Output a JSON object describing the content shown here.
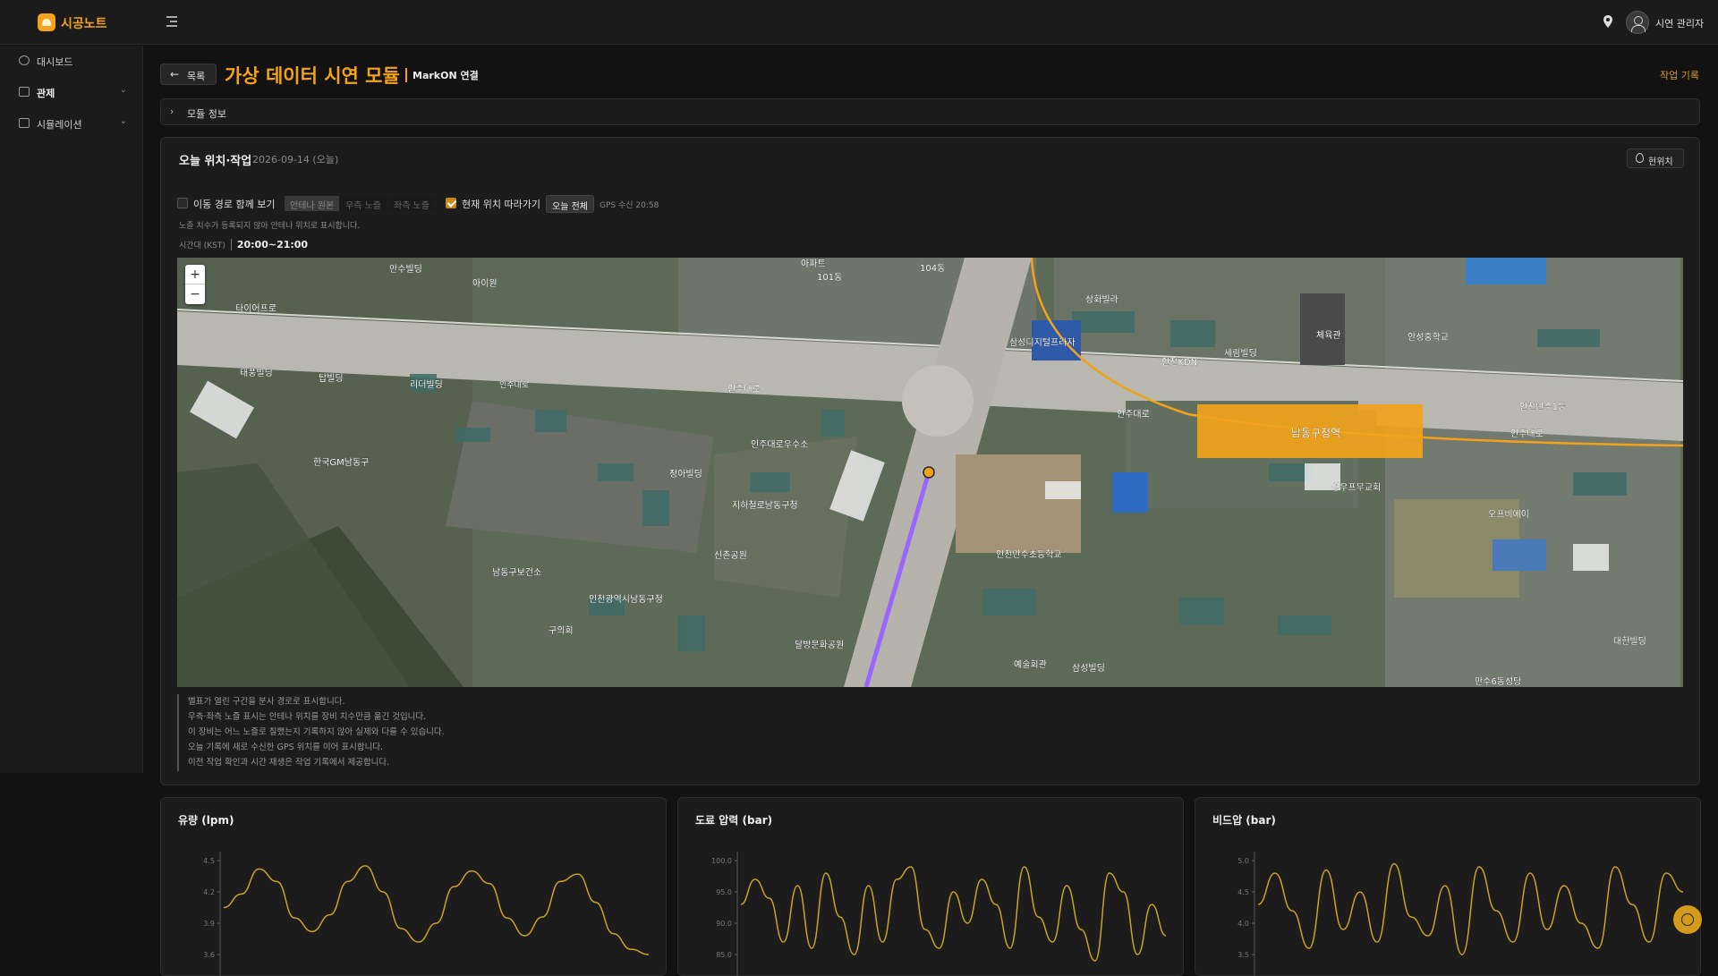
{
  "app": {
    "brand": "시공노트",
    "user": "시연 관리자"
  },
  "sidebar": {
    "items": [
      {
        "label": "대시보드",
        "icon": "dashboard-icon"
      },
      {
        "label": "관제",
        "icon": "monitor-grid-icon",
        "expandable": true
      },
      {
        "label": "시뮬레이션",
        "icon": "screen-icon",
        "expandable": true
      }
    ]
  },
  "header": {
    "back_label": "목록",
    "title": "가상 데이터 시연 모듈",
    "tag": "MarkON 연결",
    "work_log": "작업 기록"
  },
  "module_info": {
    "label": "모듈 정보"
  },
  "location_card": {
    "title": "오늘 위치·작업",
    "date": "2026-09-14 (오늘)",
    "current_location_btn": "현위치",
    "show_route_label": "이동 경로 함께 보기",
    "show_route_checked": false,
    "view_modes": [
      "안테나 원본",
      "우측 노즐",
      "좌측 노즐"
    ],
    "view_mode_selected": "안테나 원본",
    "follow_label": "현재 위치 따라가기",
    "follow_checked": true,
    "today_all_btn": "오늘 전체",
    "gps_received": "GPS 수신 20:58",
    "note": "노즐 치수가 등록되지 않아 안테나 위치로 표시합니다.",
    "time_label": "시간대 (KST)",
    "time_range": "20:00~21:00",
    "map_labels": {
      "l1": "만수빌딩",
      "l2": "아이원",
      "l3": "타이어프로",
      "l4": "인주대로",
      "l5": "인주대로",
      "l6": "인주대로",
      "l7": "인주대로",
      "l8": "삼성디지털프라자",
      "l9": "체육관",
      "l10": "인천KDN",
      "l11": "상화빌라",
      "l12": "남동구청역",
      "l13": "성우프무교회",
      "l14": "한국GM남동구",
      "l15": "남동구보건소",
      "l16": "인천광역시남동구청",
      "l17": "구의회",
      "l18": "신촌공원",
      "l19": "인천만수초등학교",
      "l20": "삼성빌딩",
      "l21": "예술회관",
      "l22": "세림빌딩",
      "l23": "인천만수1동",
      "l24": "대한빌딩",
      "l25": "104동",
      "l26": "101동",
      "l27": "태풍빌딩",
      "l28": "탑빌딩",
      "l29": "리더빌딩",
      "l30": "인주대로우수소",
      "l31": "정아빌딩",
      "l32": "지하철로남동구청",
      "l33": "달방문화공원",
      "l34": "오프비에이",
      "l35": "안성중학교",
      "l36": "만수6동성당",
      "l37": "아파트"
    },
    "legend": [
      "별표가 열린 구간을 분사 경로로 표시합니다.",
      "우측·좌측 노즐 표시는 안테나 위치를 장비 치수만큼 옮긴 것입니다.",
      "이 장비는 어느 노즐로 칠했는지 기록하지 않아 실제와 다를 수 있습니다.",
      "오늘 기록에 새로 수신한 GPS 위치를 이어 표시합니다.",
      "이전 작업 확인과 시간 재생은 작업 기록에서 제공합니다."
    ]
  },
  "charts": {
    "flow_title": "유량 (lpm)",
    "paint_title": "도료 압력 (bar)",
    "bead_title": "비드압 (bar)"
  },
  "chart_data": [
    {
      "type": "line",
      "title": "유량 (lpm)",
      "ylim": [
        3.6,
        4.5
      ],
      "yticks": [
        "4.5",
        "4.2",
        "3.9",
        "3.6"
      ],
      "series": [
        {
          "values": [
            4.05,
            4.18,
            4.42,
            4.3,
            3.95,
            3.82,
            3.98,
            4.3,
            4.45,
            4.2,
            3.85,
            3.72,
            3.9,
            4.25,
            4.4,
            4.28,
            3.95,
            3.78,
            3.96,
            4.3,
            4.37,
            4.1,
            3.8,
            3.65,
            3.6
          ]
        }
      ],
      "color": "#c9a227"
    },
    {
      "type": "line",
      "title": "도료 압력 (bar)",
      "ylim": [
        85,
        100
      ],
      "yticks": [
        "100.0",
        "95.0",
        "90.0",
        "85.0"
      ],
      "series": [
        {
          "values": [
            93,
            97,
            94,
            87,
            96,
            86,
            98,
            91,
            85,
            96,
            87,
            97,
            99,
            89,
            86,
            95,
            90,
            97,
            93,
            86,
            99,
            91,
            87,
            96,
            89,
            84,
            98,
            95,
            85,
            93,
            88
          ]
        }
      ],
      "color": "#c9a227"
    },
    {
      "type": "line",
      "title": "비드압 (bar)",
      "ylim": [
        3.5,
        5.0
      ],
      "yticks": [
        "5.0",
        "4.5",
        "4.0",
        "3.5"
      ],
      "series": [
        {
          "values": [
            4.3,
            4.8,
            4.2,
            3.6,
            4.85,
            3.9,
            4.5,
            3.7,
            4.95,
            4.1,
            3.8,
            4.6,
            3.5,
            4.9,
            4.2,
            3.7,
            4.8,
            3.9,
            4.6,
            4.0,
            3.6,
            4.9,
            4.3,
            3.7,
            4.8,
            4.5
          ]
        }
      ],
      "color": "#c9a227"
    }
  ]
}
